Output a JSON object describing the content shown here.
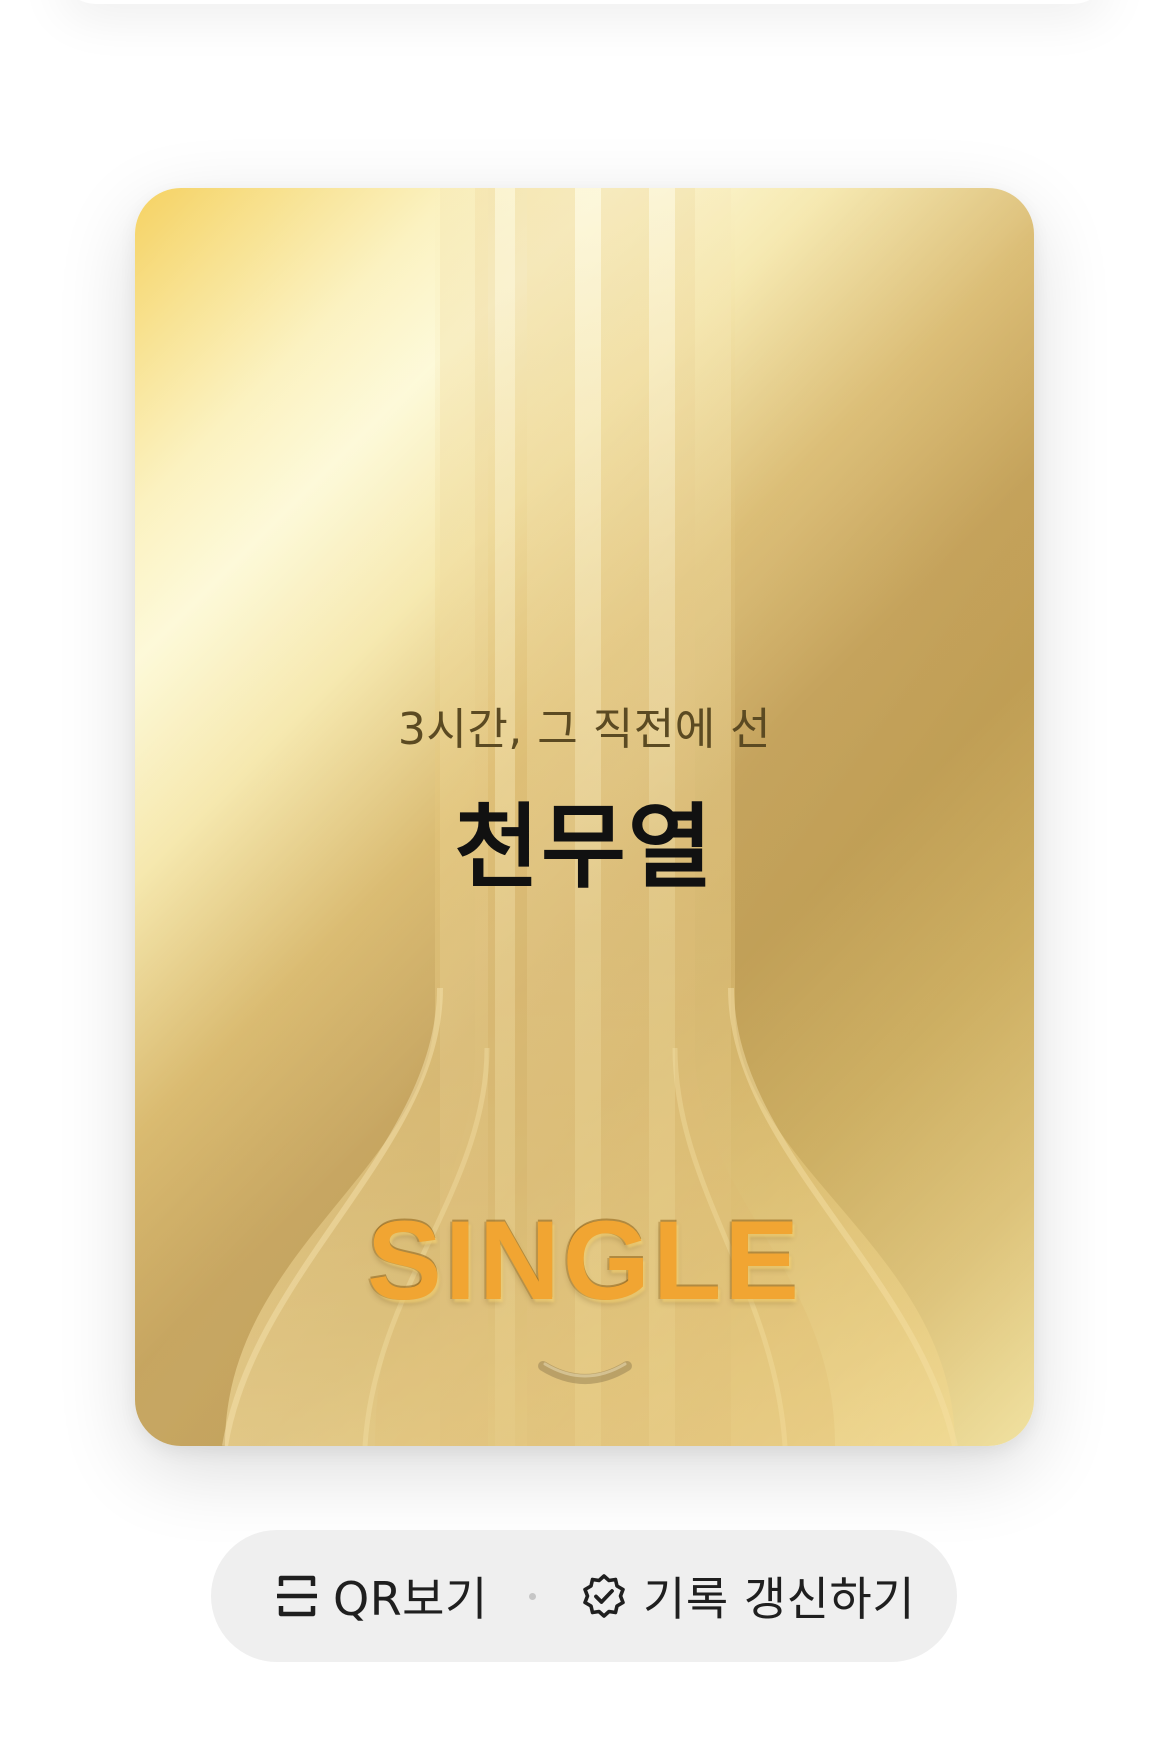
{
  "card": {
    "subtitle": "3시간, 그 직전에 선",
    "name": "천무열",
    "tier": "SINGLE",
    "expand_icon": "chevron-down-icon"
  },
  "actions": {
    "qr": {
      "label": "QR보기",
      "icon": "qr-scan-icon"
    },
    "renew": {
      "label": "기록 갱신하기",
      "icon": "verified-badge-icon"
    }
  },
  "colors": {
    "card_gold_light": "#fdf9d6",
    "card_gold_dark": "#b8923f",
    "tier_text": "#f1a532",
    "action_bar_bg": "#efefef"
  }
}
